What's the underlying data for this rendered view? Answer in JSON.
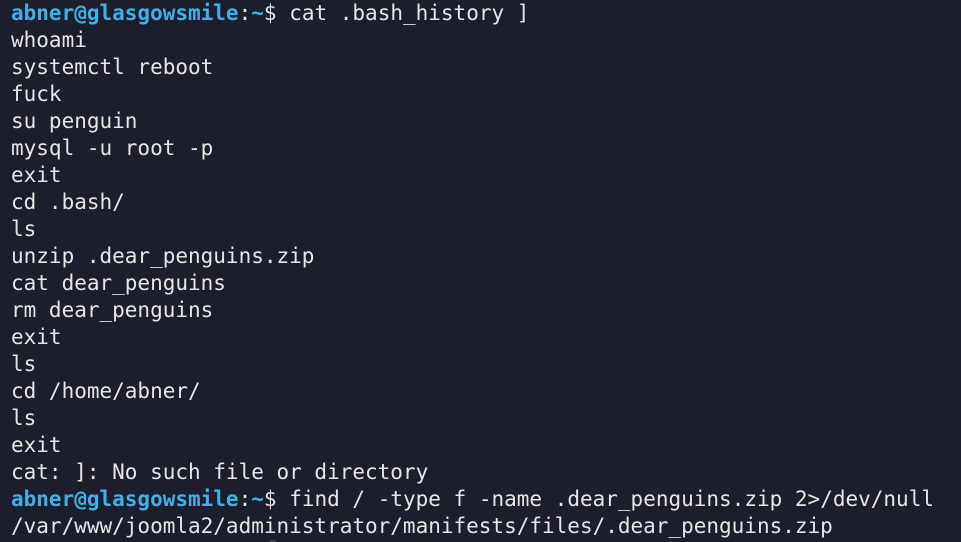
{
  "terminal": {
    "prompt_user_host": "abner@glasgowsmile",
    "prompt_separator": ":",
    "prompt_path": "~",
    "prompt_dollar": "$ ",
    "command_1": "cat .bash_history ]",
    "history_lines": [
      "whoami",
      "systemctl reboot",
      "fuck",
      "su penguin",
      "mysql -u root -p",
      "exit",
      "cd .bash/",
      "ls",
      "unzip .dear_penguins.zip",
      "cat dear_penguins",
      "rm dear_penguins",
      "exit",
      "ls",
      "cd /home/abner/",
      "ls",
      "exit"
    ],
    "error_line": "cat: ]: No such file or directory",
    "command_2": "find / -type f -name .dear_penguins.zip 2>/dev/null",
    "result_line": "/var/www/joomla2/administrator/manifests/files/.dear_penguins.zip"
  },
  "colors": {
    "background": "#1c1f2b",
    "prompt": "#3fb1e8",
    "text": "#e6e6e6"
  }
}
